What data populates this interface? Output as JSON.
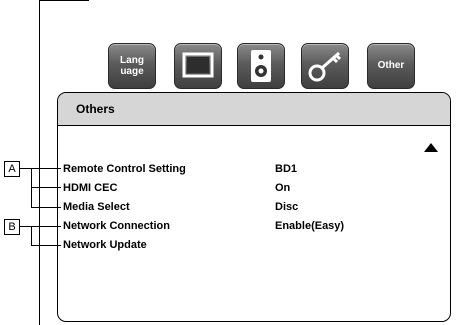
{
  "icons": [
    {
      "name": "language",
      "label": "Lang\nuage"
    },
    {
      "name": "display",
      "label": ""
    },
    {
      "name": "audio",
      "label": ""
    },
    {
      "name": "lock",
      "label": ""
    },
    {
      "name": "other",
      "label": "Other"
    }
  ],
  "panel": {
    "title": "Others",
    "rows": [
      {
        "label": "Remote Control Setting",
        "value": "BD1"
      },
      {
        "label": "HDMI CEC",
        "value": "On"
      },
      {
        "label": "Media Select",
        "value": "Disc"
      },
      {
        "label": "Network Connection",
        "value": "Enable(Easy)"
      },
      {
        "label": "Network Update",
        "value": ""
      }
    ]
  },
  "callouts": {
    "a": "A",
    "b": "B"
  }
}
